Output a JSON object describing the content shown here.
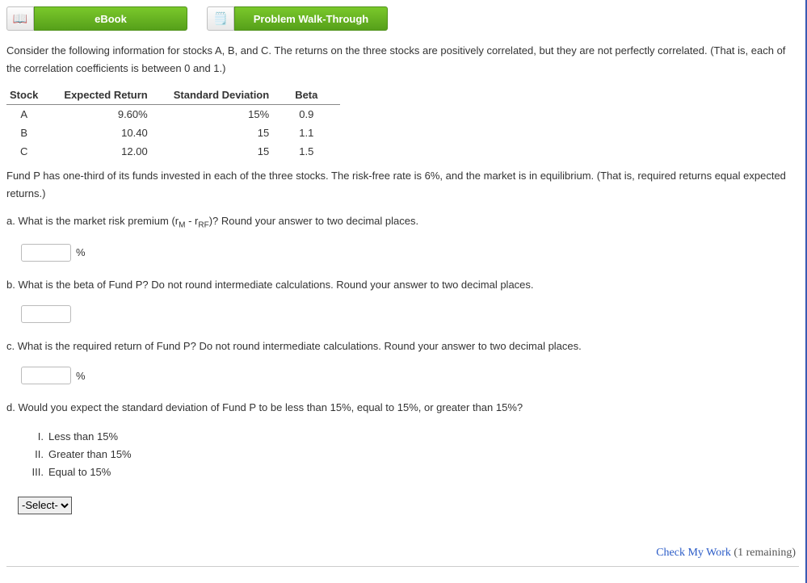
{
  "toolbar": {
    "ebook_label": "eBook",
    "walkthrough_label": "Problem Walk-Through"
  },
  "intro": "Consider the following information for stocks A, B, and C. The returns on the three stocks are positively correlated, but they are not perfectly correlated. (That is, each of the correlation coefficients is between 0 and 1.)",
  "table": {
    "headers": {
      "c0": "Stock",
      "c1": "Expected Return",
      "c2": "Standard Deviation",
      "c3": "Beta"
    },
    "rows": [
      {
        "stock": "A",
        "er": "9.60%",
        "sd": "15%",
        "beta": "0.9"
      },
      {
        "stock": "B",
        "er": "10.40",
        "sd": "15",
        "beta": "1.1"
      },
      {
        "stock": "C",
        "er": "12.00",
        "sd": "15",
        "beta": "1.5"
      }
    ]
  },
  "post_table": "Fund P has one-third of its funds invested in each of the three stocks. The risk-free rate is 6%, and the market is in equilibrium. (That is, required returns equal expected returns.)",
  "questions": {
    "a_pre": "a. What is the market risk premium (r",
    "a_sub1": "M",
    "a_mid": " - r",
    "a_sub2": "RF",
    "a_post": ")? Round your answer to two decimal places.",
    "b": "b. What is the beta of Fund P? Do not round intermediate calculations. Round your answer to two decimal places.",
    "c": "c. What is the required return of Fund P? Do not round intermediate calculations. Round your answer to two decimal places.",
    "d": "d. Would you expect the standard deviation of Fund P to be less than 15%, equal to 15%, or greater than 15%?"
  },
  "unit_pct": "%",
  "options_d": {
    "o1n": "I.",
    "o1t": "Less than 15%",
    "o2n": "II.",
    "o2t": "Greater than 15%",
    "o3n": "III.",
    "o3t": "Equal to 15%"
  },
  "select_placeholder": "-Select-",
  "footer": {
    "check": "Check My Work",
    "remaining": " (1 remaining)"
  },
  "chart_data": {
    "type": "table",
    "columns": [
      "Stock",
      "Expected Return",
      "Standard Deviation",
      "Beta"
    ],
    "rows": [
      [
        "A",
        9.6,
        15,
        0.9
      ],
      [
        "B",
        10.4,
        15,
        1.1
      ],
      [
        "C",
        12.0,
        15,
        1.5
      ]
    ],
    "note": "Expected Return and Standard Deviation in percent"
  }
}
